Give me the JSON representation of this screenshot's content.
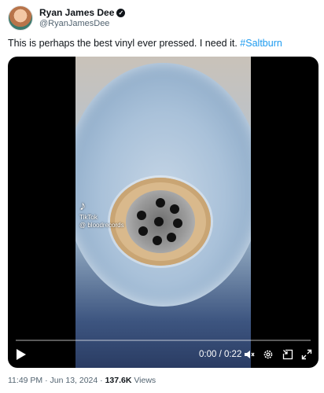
{
  "author": {
    "display_name": "Ryan James Dee",
    "handle": "@RyanJamesDee",
    "verified_mark": "✓"
  },
  "tweet": {
    "text": "This is perhaps the best vinyl ever pressed. I need it. ",
    "hashtag": "#Saltburn"
  },
  "video": {
    "watermark_brand": "TikTok",
    "watermark_user": "@ bloodrecords",
    "time": "0:00 / 0:22",
    "progress": 0,
    "icons": [
      "play-icon",
      "mute-icon",
      "settings-icon",
      "picture-in-picture-icon",
      "fullscreen-icon"
    ]
  },
  "footer": {
    "time": "11:49 PM",
    "sep1": " · ",
    "date": "Jun 13, 2024",
    "sep2": " · ",
    "views": "137.6K",
    "views_label": " Views"
  },
  "colors": {
    "accent": "#1d9bf0",
    "text": "#0f1419",
    "muted": "#536471"
  }
}
